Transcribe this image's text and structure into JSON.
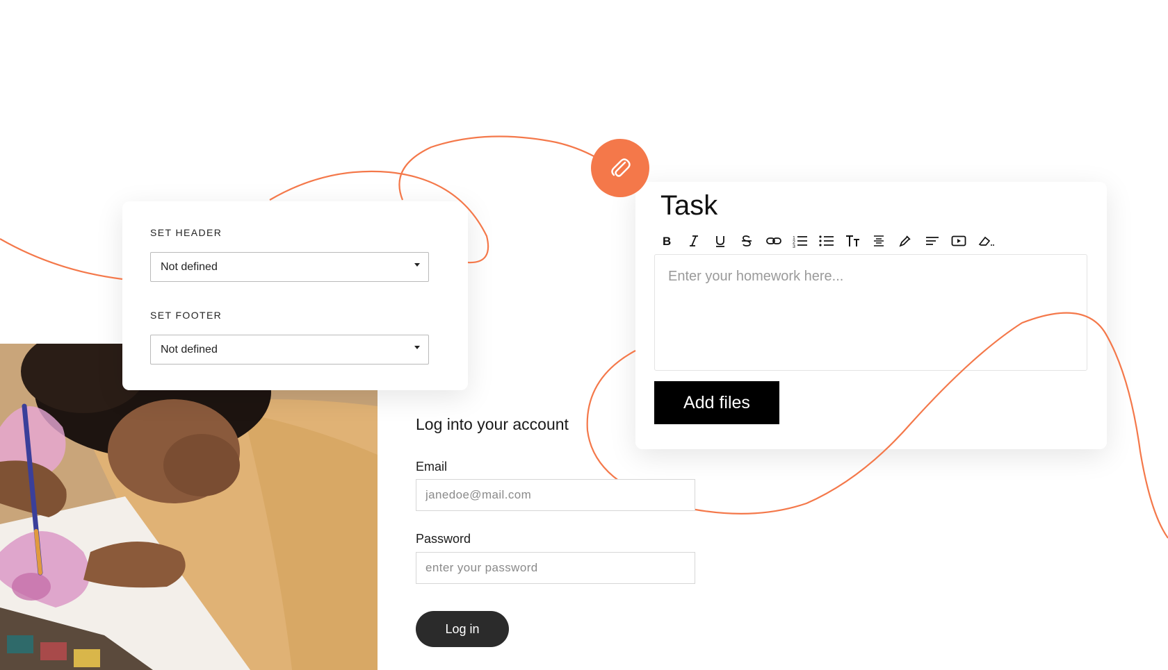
{
  "settings": {
    "header_label": "SET HEADER",
    "header_value": "Not defined",
    "footer_label": "SET FOOTER",
    "footer_value": "Not defined"
  },
  "task": {
    "title": "Task",
    "editor_placeholder": "Enter your homework here...",
    "add_files_label": "Add files",
    "toolbar": [
      "bold-icon",
      "italic-icon",
      "underline-icon",
      "strikethrough-icon",
      "link-icon",
      "numbered-list-icon",
      "bulleted-list-icon",
      "text-size-icon",
      "line-height-icon",
      "color-picker-icon",
      "align-left-icon",
      "video-icon",
      "clear-format-icon"
    ]
  },
  "attach": {
    "icon": "paperclip-icon"
  },
  "login": {
    "title": "Log into your account",
    "email_label": "Email",
    "email_placeholder": "janedoe@mail.com",
    "password_label": "Password",
    "password_placeholder": "enter your password",
    "submit_label": "Log in"
  },
  "colors": {
    "accent": "#f4784a",
    "button_dark": "#000000",
    "login_button": "#2b2b2b"
  }
}
